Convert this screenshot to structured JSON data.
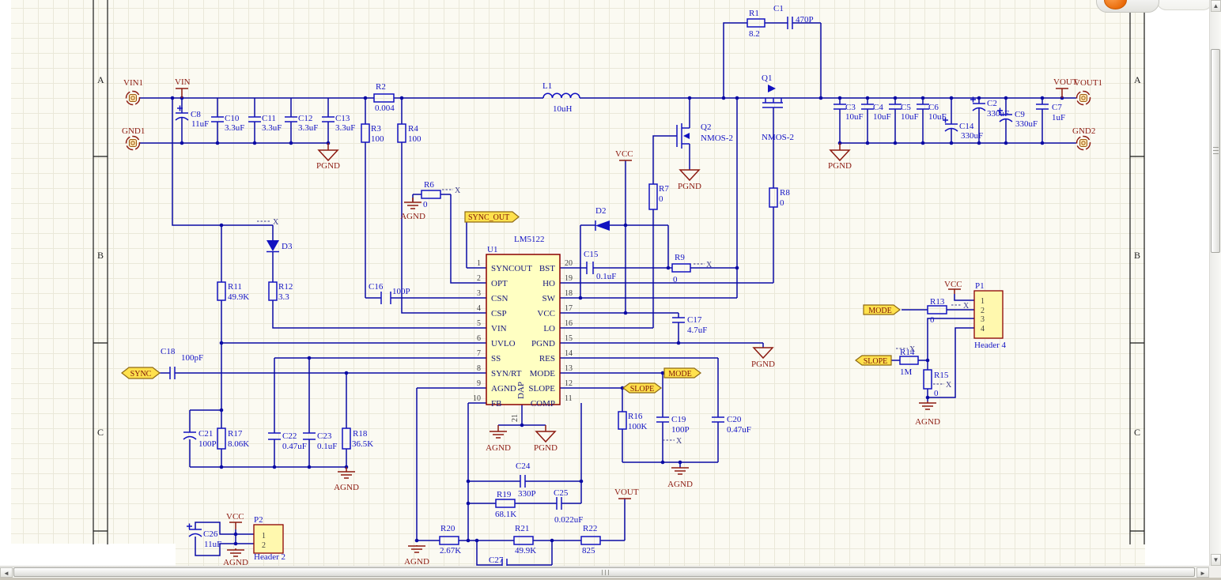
{
  "zones": [
    "A",
    "B",
    "C"
  ],
  "marker_x": "X",
  "nets": {
    "vin": "VIN",
    "vcc": "VCC",
    "vout": "VOUT",
    "pgnd": "PGND",
    "agnd": "AGND"
  },
  "sheet_ports": {
    "vin1": "VIN1",
    "gnd1": "GND1",
    "vout1": "VOUT1",
    "gnd2": "GND2"
  },
  "wire_ports": {
    "sync_out": "SYNC_OUT",
    "sync": "SYNC",
    "mode": "MODE",
    "slope": "SLOPE"
  },
  "u1": {
    "ref": "U1",
    "part": "LM5122",
    "dap": "DAP",
    "dap_pin": "21",
    "pins_left": [
      [
        "1",
        "SYNCOUT"
      ],
      [
        "2",
        "OPT"
      ],
      [
        "3",
        "CSN"
      ],
      [
        "4",
        "CSP"
      ],
      [
        "5",
        "VIN"
      ],
      [
        "6",
        "UVLO"
      ],
      [
        "7",
        "SS"
      ],
      [
        "8",
        "SYN/RT"
      ],
      [
        "9",
        "AGND"
      ],
      [
        "10",
        "FB"
      ]
    ],
    "pins_right": [
      [
        "20",
        "BST"
      ],
      [
        "19",
        "HO"
      ],
      [
        "18",
        "SW"
      ],
      [
        "17",
        "VCC"
      ],
      [
        "16",
        "LO"
      ],
      [
        "15",
        "PGND"
      ],
      [
        "14",
        "RES"
      ],
      [
        "13",
        "MODE"
      ],
      [
        "12",
        "SLOPE"
      ],
      [
        "11",
        "COMP"
      ]
    ]
  },
  "p1": {
    "ref": "P1",
    "type": "Header 4",
    "pins": [
      "1",
      "2",
      "3",
      "4"
    ]
  },
  "p2": {
    "ref": "P2",
    "type": "Header 2",
    "pins": [
      "1",
      "2"
    ]
  },
  "parts": {
    "R1": {
      "ref": "R1",
      "val": "8.2"
    },
    "R2": {
      "ref": "R2",
      "val": "0.004"
    },
    "R3": {
      "ref": "R3",
      "val": "100"
    },
    "R4": {
      "ref": "R4",
      "val": "100"
    },
    "R6": {
      "ref": "R6",
      "val": "0"
    },
    "R7": {
      "ref": "R7",
      "val": "0"
    },
    "R8": {
      "ref": "R8",
      "val": "0"
    },
    "R9": {
      "ref": "R9",
      "val": "0"
    },
    "R11": {
      "ref": "R11",
      "val": "49.9K"
    },
    "R12": {
      "ref": "R12",
      "val": "3.3"
    },
    "R13": {
      "ref": "R13",
      "val": "0"
    },
    "R14": {
      "ref": "R14",
      "val": "1M"
    },
    "R15": {
      "ref": "R15",
      "val": "0"
    },
    "R16": {
      "ref": "R16",
      "val": "100K"
    },
    "R17": {
      "ref": "R17",
      "val": "8.06K"
    },
    "R18": {
      "ref": "R18",
      "val": "36.5K"
    },
    "R19": {
      "ref": "R19",
      "val": "68.1K"
    },
    "R20": {
      "ref": "R20",
      "val": "2.67K"
    },
    "R21": {
      "ref": "R21",
      "val": "49.9K"
    },
    "R22": {
      "ref": "R22",
      "val": "825"
    },
    "C1": {
      "ref": "C1",
      "val": "470P"
    },
    "C2": {
      "ref": "C2",
      "val": "330uF"
    },
    "C3": {
      "ref": "C3",
      "val": "10uF"
    },
    "C4": {
      "ref": "C4",
      "val": "10uF"
    },
    "C5": {
      "ref": "C5",
      "val": "10uF"
    },
    "C6": {
      "ref": "C6",
      "val": "10uF"
    },
    "C7": {
      "ref": "C7",
      "val": "1uF"
    },
    "C8": {
      "ref": "C8",
      "val": "11uF"
    },
    "C9": {
      "ref": "C9",
      "val": "330uF"
    },
    "C10": {
      "ref": "C10",
      "val": "3.3uF"
    },
    "C11": {
      "ref": "C11",
      "val": "3.3uF"
    },
    "C12": {
      "ref": "C12",
      "val": "3.3uF"
    },
    "C13": {
      "ref": "C13",
      "val": "3.3uF"
    },
    "C14": {
      "ref": "C14",
      "val": "330uF"
    },
    "C15": {
      "ref": "C15",
      "val": "0.1uF"
    },
    "C16": {
      "ref": "C16",
      "val": "100P"
    },
    "C17": {
      "ref": "C17",
      "val": "4.7uF"
    },
    "C18": {
      "ref": "C18",
      "val": "100pF"
    },
    "C19": {
      "ref": "C19",
      "val": "100P"
    },
    "C20": {
      "ref": "C20",
      "val": "0.47uF"
    },
    "C21": {
      "ref": "C21",
      "val": "100P"
    },
    "C22": {
      "ref": "C22",
      "val": "0.47uF"
    },
    "C23": {
      "ref": "C23",
      "val": "0.1uF"
    },
    "C24": {
      "ref": "C24",
      "val": "330P"
    },
    "C25": {
      "ref": "C25",
      "val": "0.022uF"
    },
    "C26": {
      "ref": "C26",
      "val": "11uF"
    },
    "C27": {
      "ref": "C27"
    },
    "L1": {
      "ref": "L1",
      "val": "10uH"
    },
    "D2": {
      "ref": "D2"
    },
    "D3": {
      "ref": "D3"
    },
    "Q1": {
      "ref": "Q1",
      "type": "NMOS-2"
    },
    "Q2": {
      "ref": "Q2",
      "type": "NMOS-2"
    }
  }
}
